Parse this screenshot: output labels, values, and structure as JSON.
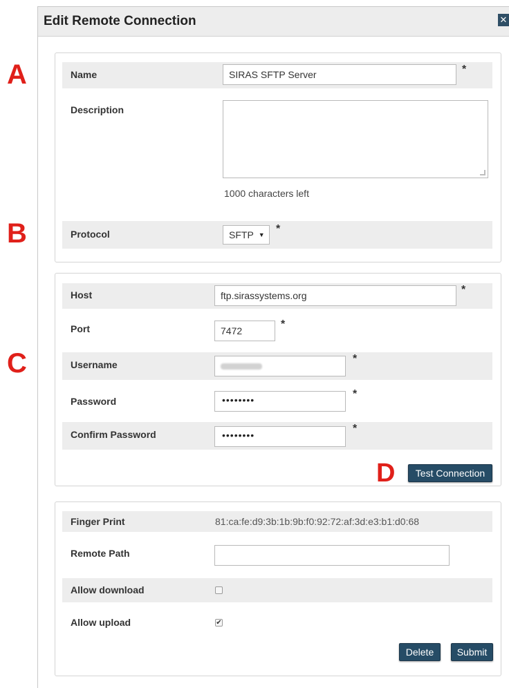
{
  "markers": {
    "a": "A",
    "b": "B",
    "c": "C",
    "d": "D"
  },
  "dialog": {
    "title": "Edit Remote Connection",
    "close_icon": "close-icon"
  },
  "general": {
    "name_label": "Name",
    "name_value": "SIRAS SFTP Server",
    "description_label": "Description",
    "description_value": "",
    "chars_left": "1000 characters left",
    "protocol_label": "Protocol",
    "protocol_value": "SFTP",
    "required_mark": "*"
  },
  "connection": {
    "host_label": "Host",
    "host_value": "ftp.sirassystems.org",
    "port_label": "Port",
    "port_value": "7472",
    "username_label": "Username",
    "password_label": "Password",
    "password_value": "••••••••",
    "confirm_label": "Confirm Password",
    "confirm_value": "••••••••",
    "test_button": "Test Connection"
  },
  "settings": {
    "fingerprint_label": "Finger Print",
    "fingerprint_value": "81:ca:fe:d9:3b:1b:9b:f0:92:72:af:3d:e3:b1:d0:68",
    "remote_path_label": "Remote Path",
    "remote_path_value": "",
    "allow_download_label": "Allow download",
    "allow_download_checked": false,
    "allow_upload_label": "Allow upload",
    "allow_upload_checked": true,
    "delete_button": "Delete",
    "submit_button": "Submit"
  },
  "colors": {
    "marker": "#e0201a",
    "button": "#264c66",
    "shade": "#ededed"
  }
}
